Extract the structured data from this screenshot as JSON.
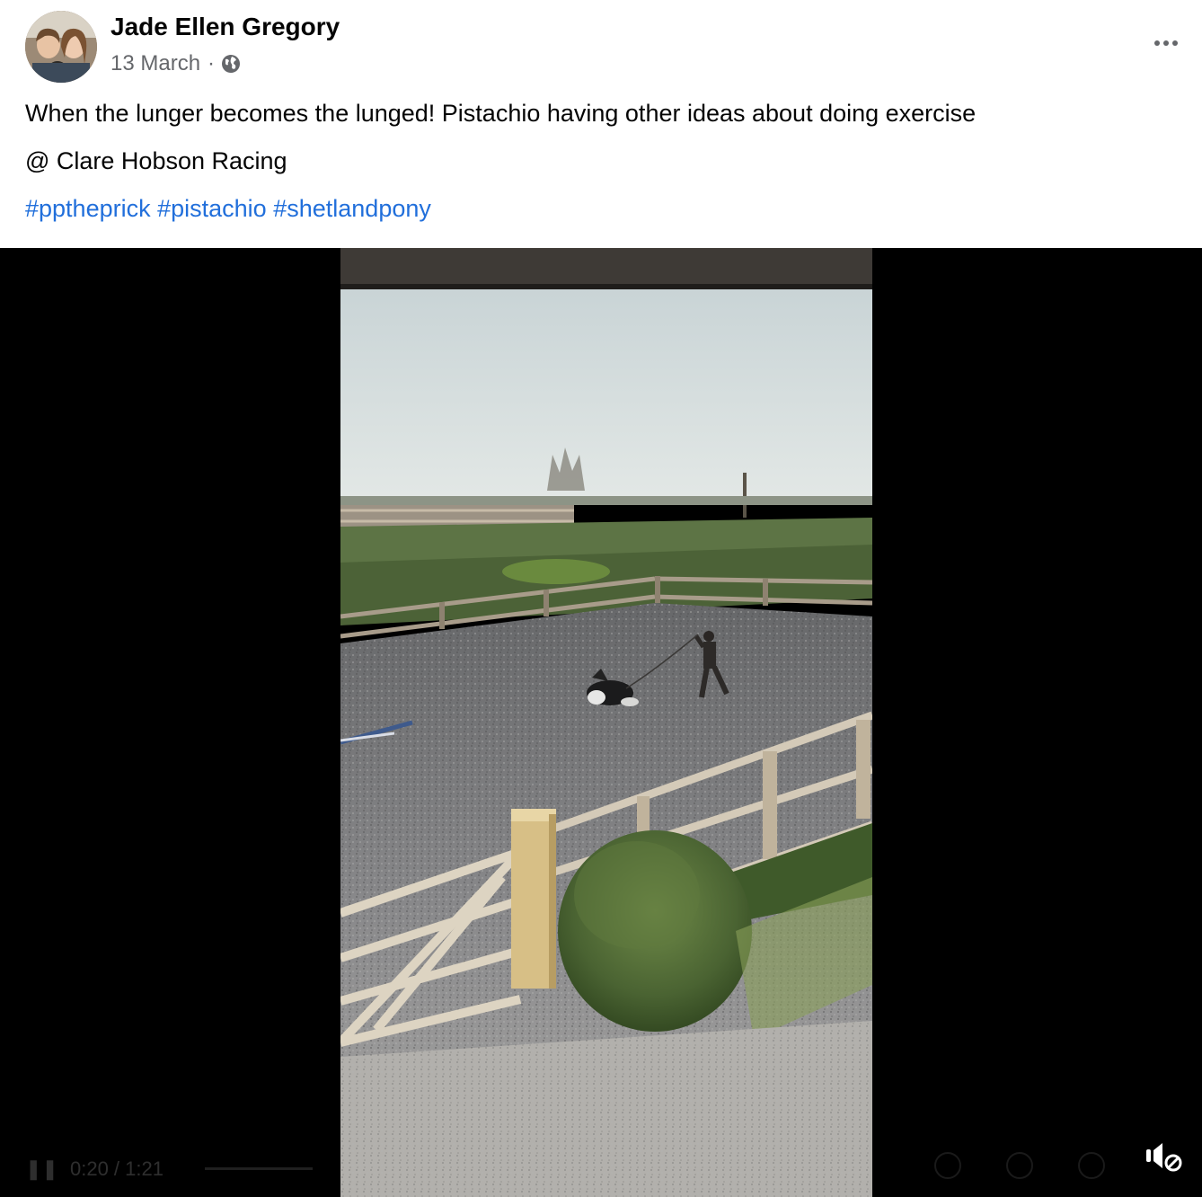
{
  "post": {
    "author": "Jade Ellen Gregory",
    "date": "13 March",
    "separator": "·",
    "privacy_icon": "globe-icon",
    "menu_icon": "more-horizontal-icon"
  },
  "body": {
    "line1": "When the lunger becomes the lunged! Pistachio having other ideas about doing exercise",
    "mention_line": "@ Clare Hobson Racing",
    "hashtags": [
      "#pptheprick",
      "#pistachio",
      "#shetlandpony"
    ]
  },
  "video": {
    "time": "0:20 / 1:21",
    "mute_icon": "muted-speaker-icon",
    "colors": {
      "background": "#000000",
      "hashtag": "#216fdb",
      "meta": "#65676b"
    }
  }
}
